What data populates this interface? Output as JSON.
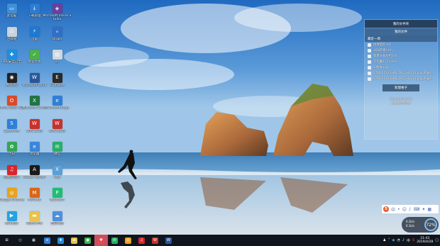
{
  "desktop": {
    "icons": [
      {
        "label": "此电脑",
        "color": "#3f8fd8",
        "glyph": "▭",
        "name": "this-pc-icon"
      },
      {
        "label": "回收站",
        "color": "#c9d3dc",
        "glyph": "♺",
        "name": "recycle-bin-icon"
      },
      {
        "label": "360安全卫士",
        "color": "#1e8ee0",
        "glyph": "✚",
        "name": "360-security-icon"
      },
      {
        "label": "腾讯QQ",
        "color": "#222222",
        "glyph": "◉",
        "name": "qq-icon"
      },
      {
        "label": "Office 2016 工具",
        "color": "#d94a2a",
        "glyph": "O",
        "name": "office-tools-icon"
      },
      {
        "label": "SpeedPan",
        "color": "#2f7fd9",
        "glyph": "S",
        "name": "speedpan-icon"
      },
      {
        "label": "小白",
        "color": "#33a652",
        "glyph": "✿",
        "name": "xiaobai-icon"
      },
      {
        "label": "网易云音乐",
        "color": "#d8262e",
        "glyph": "♫",
        "name": "netease-music-icon"
      },
      {
        "label": "Google Chrome",
        "color": "#e8a31b",
        "glyph": "◎",
        "name": "chrome-icon"
      },
      {
        "label": "腾讯视频",
        "color": "#23a3e0",
        "glyph": "▶",
        "name": "tencent-video-icon"
      },
      {
        "label": "下载管理",
        "color": "#2d7cd4",
        "glyph": "↓",
        "name": "download-manager-icon"
      },
      {
        "label": "迅雷",
        "color": "#1f78d1",
        "glyph": "⚡",
        "name": "xunlei-icon"
      },
      {
        "label": "优化大师",
        "color": "#4bb14b",
        "glyph": "✓",
        "name": "optimizer-icon"
      },
      {
        "label": "Microsoft Word",
        "color": "#2b579a",
        "glyph": "W",
        "name": "word-icon"
      },
      {
        "label": "Microsoft Excel",
        "color": "#217346",
        "glyph": "X",
        "name": "excel-icon"
      },
      {
        "label": "WPS 2019",
        "color": "#c9302c",
        "glyph": "W",
        "name": "wps-icon"
      },
      {
        "label": "浏览器",
        "color": "#3a86d8",
        "glyph": "e",
        "name": "browser-icon"
      },
      {
        "label": "Adobe Reader",
        "color": "#1a1a1a",
        "glyph": "A",
        "name": "adobe-reader-icon"
      },
      {
        "label": "MATLAB",
        "color": "#d9661c",
        "glyph": "M",
        "name": "matlab-icon"
      },
      {
        "label": "新建文件夹",
        "color": "#e8c24a",
        "glyph": "▬",
        "name": "new-folder-icon"
      },
      {
        "label": "Microsoft Visual Studio",
        "color": "#6b3fa0",
        "glyph": "◈",
        "name": "visual-studio-icon"
      },
      {
        "label": "Origin",
        "color": "#2f6fc7",
        "glyph": "ℴ",
        "name": "origin-icon"
      },
      {
        "label": "ss",
        "color": "#cfd8e0",
        "glyph": "▤",
        "name": "ss-file-icon"
      },
      {
        "label": "EndNote",
        "color": "#2a2a2a",
        "glyph": "E",
        "name": "endnote-icon"
      },
      {
        "label": "Microsoft Edge",
        "color": "#2f7fd9",
        "glyph": "e",
        "name": "edge-icon"
      },
      {
        "label": "WPS 2019",
        "color": "#c9302c",
        "glyph": "W",
        "name": "wps2-icon"
      },
      {
        "label": "微信",
        "color": "#2aae67",
        "glyph": "✉",
        "name": "wechat-icon"
      },
      {
        "label": "Xftp",
        "color": "#5a9fd8",
        "glyph": "X",
        "name": "xftp-icon"
      },
      {
        "label": "PyCharm",
        "color": "#1dbf73",
        "glyph": "P",
        "name": "pycharm-icon"
      },
      {
        "label": "百度网盘",
        "color": "#4d90e0",
        "glyph": "☁",
        "name": "baidu-netdisk-icon"
      }
    ]
  },
  "files_panel": {
    "title": "我的文件夹",
    "sub": "我的文件",
    "section": "最近一周",
    "items": [
      "搞清楚的.txt",
      "360转储.htm",
      "新建文本文档.txt",
      "工作量2 (1).xlsx",
      "1.图本.jpg",
      "STM32F103x8B_DS_CH_V10.jpg_Page...",
      "STM32F103x8B_DS_CH_V10.jpg_Page..."
    ],
    "new_button": "新建格子",
    "tip": "双击以添加格子或\n拖拽文件到此处"
  },
  "ime": {
    "logo": "S",
    "label": "中"
  },
  "net": {
    "up": "0.2k/s",
    "down": "0.1k/s",
    "percent": "72%"
  },
  "taskbar": {
    "apps": [
      {
        "name": "start-button",
        "glyph": "⊞",
        "color": "#10151d"
      },
      {
        "name": "search-taskbar-icon",
        "glyph": "○",
        "color": "#10151d"
      },
      {
        "name": "task-view-icon",
        "glyph": "▦",
        "color": "#10151d"
      },
      {
        "name": "taskbar-browser-icon",
        "glyph": "e",
        "color": "#2f7fd9"
      },
      {
        "name": "taskbar-360-icon",
        "glyph": "✚",
        "color": "#1e8ee0"
      },
      {
        "name": "taskbar-explorer-icon",
        "glyph": "▬",
        "color": "#e8c24a"
      },
      {
        "name": "taskbar-green-app-icon",
        "glyph": "●",
        "color": "#3cb54a"
      },
      {
        "name": "taskbar-active-app-icon",
        "glyph": "♥",
        "color": "#e04b5c"
      },
      {
        "name": "taskbar-wechat-icon",
        "glyph": "✉",
        "color": "#2aae67"
      },
      {
        "name": "taskbar-chrome-icon",
        "glyph": "◎",
        "color": "#e8a31b"
      },
      {
        "name": "taskbar-netease-icon",
        "glyph": "♫",
        "color": "#d8262e"
      },
      {
        "name": "taskbar-wps-icon",
        "glyph": "W",
        "color": "#c9302c"
      },
      {
        "name": "taskbar-word-icon",
        "glyph": "W",
        "color": "#2b579a"
      }
    ],
    "clock_time": "21:43",
    "clock_date": "2019/4/28",
    "tray_lang": "中"
  }
}
